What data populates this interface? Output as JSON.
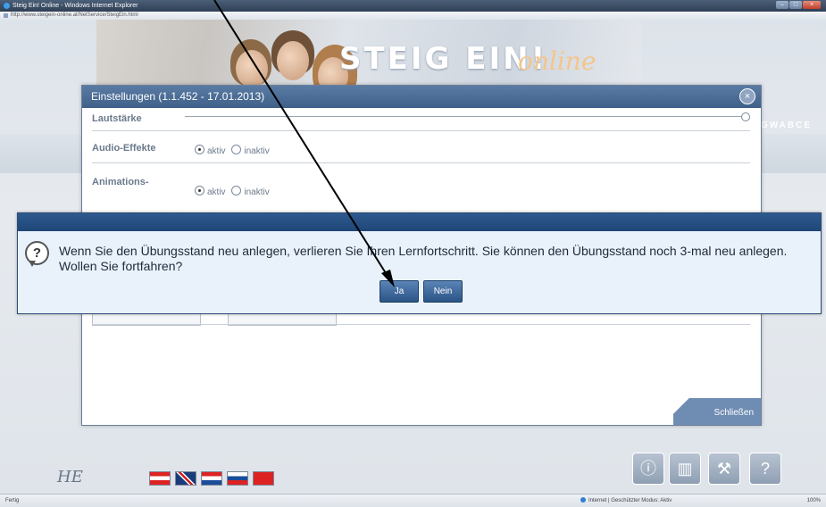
{
  "browser": {
    "title": "Steig Ein! Online - Windows Internet Explorer",
    "url": "http://www.steigein-online.at/NetService/SteigEin.html",
    "status_left": "Fertig",
    "status_zone": "Internet | Geschützter Modus: Aktiv",
    "zoom": "100%"
  },
  "banner": {
    "logo": "STEIG EIN!",
    "logo_sub": "online"
  },
  "alphabet_strip": "GWABCE",
  "settings": {
    "title": "Einstellungen (1.1.452 - 17.01.2013)",
    "rows": [
      {
        "label": "Lautstärke"
      },
      {
        "label": "Audio-Effekte",
        "options": [
          "aktiv",
          "inaktiv"
        ],
        "selected": "aktiv"
      },
      {
        "label": "Animations-",
        "options": [
          "aktiv",
          "inaktiv"
        ],
        "selected": "aktiv"
      }
    ],
    "close_label": "Schließen"
  },
  "confirm": {
    "message": "Wenn Sie den Übungsstand neu anlegen, verlieren Sie Ihren Lernfortschritt. Sie können den Übungsstand noch 3-mal neu anlegen. Wollen Sie fortfahren?",
    "yes_label": "Ja",
    "no_label": "Nein"
  },
  "footer": {
    "brand": "HE",
    "flags": [
      "at",
      "gb",
      "hr",
      "si",
      "tr"
    ],
    "tool_icons": [
      "info-icon",
      "statistics-icon",
      "wrench-icon",
      "help-icon"
    ]
  },
  "colors": {
    "dialog_header": "#3f6088",
    "modal_bar": "#1f4676",
    "button": "#2b5487"
  }
}
